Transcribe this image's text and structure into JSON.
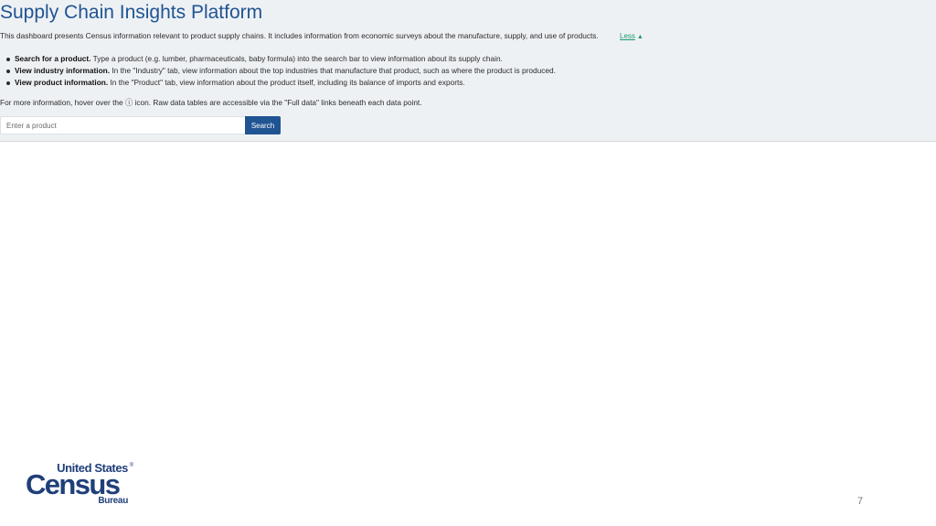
{
  "header": {
    "title": "Supply Chain Insights Platform",
    "intro": "This dashboard presents Census information relevant to product supply chains. It includes information from economic surveys about the manufacture, supply, and use of products.",
    "less_label": "Less",
    "less_arrow": "▲"
  },
  "instructions": [
    {
      "bold": "Search for a product.",
      "text": " Type a product (e.g. lumber, pharmaceuticals, baby formula) into the search bar to view information about its supply chain."
    },
    {
      "bold": "View industry information.",
      "text": " In the \"Industry\" tab, view information about the top industries that manufacture that product, such as where the product is produced."
    },
    {
      "bold": "View product information.",
      "text": " In the \"Product\" tab, view information about the product itself, including its balance of imports and exports."
    }
  ],
  "more_info": "For more information, hover over the ⓘ icon. Raw data tables are accessible via the \"Full data\" links beneath each data point.",
  "search": {
    "placeholder": "Enter a product",
    "value": "",
    "button_label": "Search"
  },
  "logo": {
    "line1": "United States",
    "registered": "®",
    "line2": "Census",
    "line3": "Bureau"
  },
  "page_number": "7",
  "colors": {
    "title": "#205493",
    "accent_link": "#1a9a6c",
    "button": "#205493",
    "panel_bg": "#eef1f4",
    "logo": "#1f3f7a"
  }
}
